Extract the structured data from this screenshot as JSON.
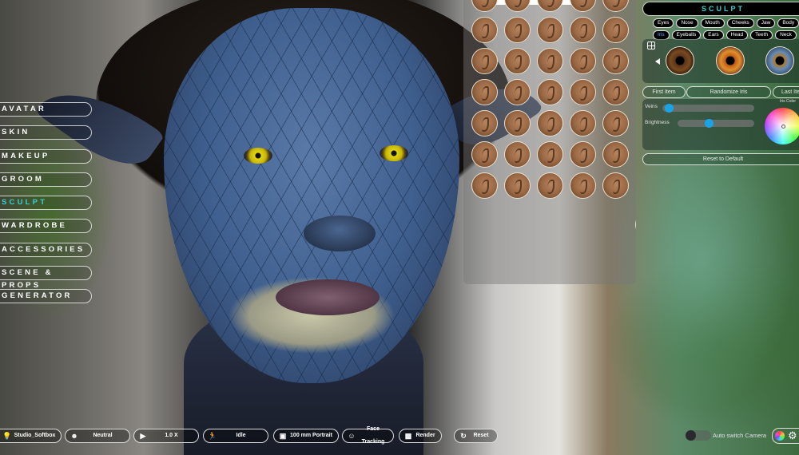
{
  "nav": {
    "items": [
      {
        "label": "AVATAR",
        "active": false
      },
      {
        "label": "SKIN",
        "active": false
      },
      {
        "label": "MAKEUP",
        "active": false
      },
      {
        "label": "GROOM",
        "active": false
      },
      {
        "label": "SCULPT",
        "active": true
      },
      {
        "label": "WARDROBE",
        "active": false
      },
      {
        "label": "ACCESSORIES",
        "active": false
      },
      {
        "label": "SCENE & PROPS",
        "active": false
      },
      {
        "label": "GENERATOR",
        "active": false
      }
    ]
  },
  "ear_grid": {
    "ear_thumbs": 35,
    "face_thumbs_row": 5,
    "last_row": 4
  },
  "sculpt_panel": {
    "title": "SCULPT",
    "tabs_row1": [
      "Eyes",
      "Nose",
      "Mouth",
      "Cheeks",
      "Jaw",
      "Body"
    ],
    "tabs_row2": [
      "Iris",
      "Eyeballs",
      "Ears",
      "Head",
      "Teeth",
      "Neck"
    ],
    "active_tab": "Iris",
    "iris_swatches": [
      "brown-iris",
      "amber-iris",
      "blue-amber-iris"
    ],
    "buttons": {
      "first": "First Item",
      "randomize": "Randomize Iris",
      "last": "Last Item",
      "reset": "Reset to Default"
    },
    "sliders": {
      "veins": {
        "label": "Veins",
        "value": 0.03
      },
      "brightness": {
        "label": "Brightness",
        "value": 0.4
      }
    },
    "iris_color_label": "Iris Color"
  },
  "toolbar": {
    "lighting": {
      "label": "Studio_Softbox",
      "icon": "lightbulb-icon"
    },
    "expression": {
      "label": "Neutral",
      "icon": "smiley-icon"
    },
    "speed": {
      "label": "1.0 X",
      "icon": "play-icon"
    },
    "pose": {
      "label": "Idle",
      "icon": "running-figure-icon"
    },
    "camera": {
      "label": "100 mm Portrait",
      "icon": "video-camera-icon"
    },
    "face_tracking": {
      "label": "Face Tracking",
      "icon": "face-tracking-icon"
    },
    "render": {
      "label": "Render",
      "icon": "render-icon"
    },
    "reset": {
      "label": "Reset",
      "icon": "reset-icon"
    },
    "auto_switch_camera": {
      "label": "Auto switch Camera",
      "on": false
    }
  },
  "colors": {
    "accent": "#3ccfcf",
    "active_tab": "#4fa4ff",
    "slider_knob": "#1aa4e8"
  }
}
